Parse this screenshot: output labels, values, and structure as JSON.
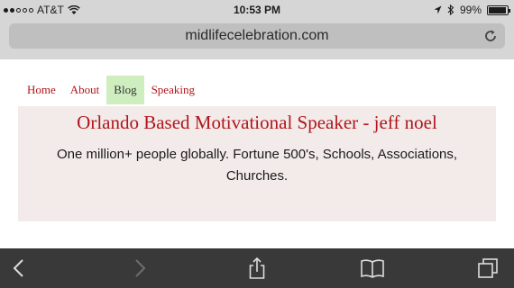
{
  "status_bar": {
    "carrier": "AT&T",
    "time": "10:53 PM",
    "battery": "99%"
  },
  "browser": {
    "url": "midlifecelebration.com"
  },
  "nav": {
    "items": [
      {
        "label": "Home"
      },
      {
        "label": "About"
      },
      {
        "label": "Blog"
      },
      {
        "label": "Speaking"
      }
    ],
    "active": "Blog"
  },
  "hero": {
    "title": "Orlando Based Motivational Speaker - jeff noel",
    "subtitle": "One million+ people globally. Fortune 500's, Schools, Associations, Churches."
  },
  "toolbar": {
    "icons": [
      "back-icon",
      "forward-icon",
      "share-icon",
      "bookmarks-icon",
      "tabs-icon"
    ]
  },
  "colors": {
    "chrome": "#d6d6d6",
    "url_bar": "#bfbfbf",
    "link": "#b2151b",
    "active_tab": "#cfeec0",
    "hero_bg": "#f2ebea",
    "toolbar": "#393939"
  }
}
